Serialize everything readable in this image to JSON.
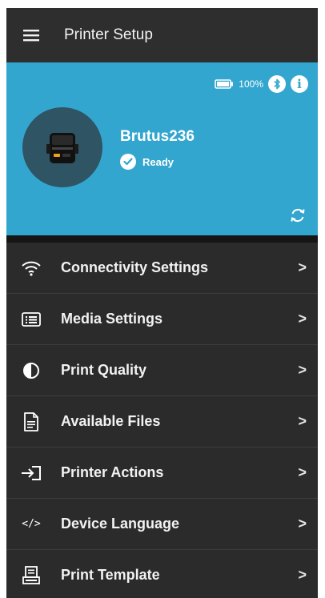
{
  "header": {
    "title": "Printer Setup",
    "menu_icon": "hamburger-icon"
  },
  "printer_card": {
    "battery_percent": "100%",
    "battery_level": 1.0,
    "device_name": "Brutus236",
    "status": "Ready",
    "accent_color": "#33a6cf"
  },
  "menu": {
    "items": [
      {
        "label": "Connectivity Settings",
        "icon": "wifi-icon"
      },
      {
        "label": "Media Settings",
        "icon": "media-list-icon"
      },
      {
        "label": "Print Quality",
        "icon": "contrast-icon"
      },
      {
        "label": "Available Files",
        "icon": "file-icon"
      },
      {
        "label": "Printer Actions",
        "icon": "enter-arrow-icon"
      },
      {
        "label": "Device Language",
        "icon": "code-icon",
        "glyph": "</>"
      },
      {
        "label": "Print Template",
        "icon": "template-printer-icon"
      }
    ],
    "chevron": ">"
  }
}
